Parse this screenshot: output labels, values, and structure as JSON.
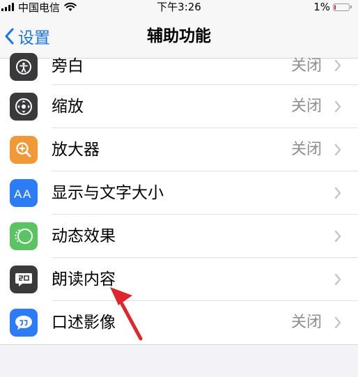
{
  "status_bar": {
    "carrier": "中国电信",
    "time": "下午3:26",
    "battery": "1%",
    "battery_level": 0.01
  },
  "nav": {
    "back_label": "设置",
    "title": "辅助功能"
  },
  "items": [
    {
      "label": "旁白",
      "value": "关闭",
      "icon": "voiceover-icon",
      "color": "#3a3a3c"
    },
    {
      "label": "缩放",
      "value": "关闭",
      "icon": "zoom-icon",
      "color": "#3a3a3c"
    },
    {
      "label": "放大器",
      "value": "关闭",
      "icon": "magnifier-icon",
      "color": "#f09a37"
    },
    {
      "label": "显示与文字大小",
      "value": "",
      "icon": "text-size-icon",
      "color": "#2c7cf6"
    },
    {
      "label": "动态效果",
      "value": "",
      "icon": "motion-icon",
      "color": "#5ac463"
    },
    {
      "label": "朗读内容",
      "value": "",
      "icon": "spoken-content-icon",
      "color": "#3a3a3c"
    },
    {
      "label": "口述影像",
      "value": "关闭",
      "icon": "audio-descriptions-icon",
      "color": "#2c7cf6"
    }
  ],
  "accent_color": "#1a73e8",
  "annotation_color": "#e0262d"
}
